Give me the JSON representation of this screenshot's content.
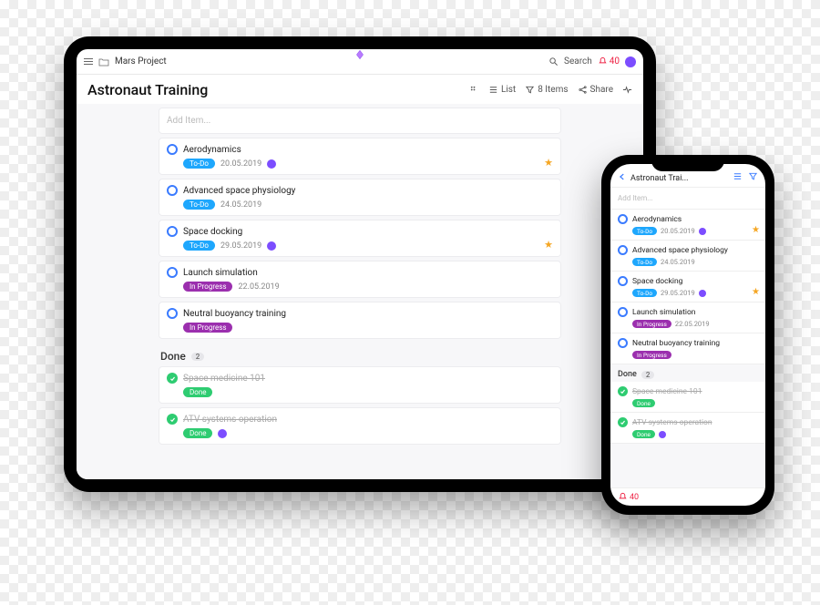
{
  "app": {
    "breadcrumb": "Mars Project",
    "search_label": "Search",
    "notif_count": "40",
    "page_title": "Astronaut Training",
    "view_label": "List",
    "items_label": "8 Items",
    "share_label": "Share",
    "add_item_placeholder": "Add Item..."
  },
  "sections": {
    "done_label": "Done",
    "done_count": "2"
  },
  "items": [
    {
      "title": "Aerodynamics",
      "status": "To-Do",
      "status_class": "todo",
      "date": "20.05.2019",
      "assignee": true,
      "starred": true
    },
    {
      "title": "Advanced space physiology",
      "status": "To-Do",
      "status_class": "todo",
      "date": "24.05.2019",
      "assignee": false,
      "starred": false
    },
    {
      "title": "Space docking",
      "status": "To-Do",
      "status_class": "todo",
      "date": "29.05.2019",
      "assignee": true,
      "starred": true
    },
    {
      "title": "Launch simulation",
      "status": "In Progress",
      "status_class": "inprogress",
      "date": "22.05.2019",
      "assignee": false,
      "starred": false
    },
    {
      "title": "Neutral buoyancy training",
      "status": "In Progress",
      "status_class": "inprogress",
      "date": "",
      "assignee": false,
      "starred": false
    }
  ],
  "done_items": [
    {
      "title": "Space medicine 101",
      "status": "Done",
      "status_class": "done",
      "assignee": false
    },
    {
      "title": "ATV systems operation",
      "status": "Done",
      "status_class": "done",
      "assignee": true
    }
  ],
  "phone": {
    "title": "Astronaut Trai...",
    "notif_count": "40"
  }
}
